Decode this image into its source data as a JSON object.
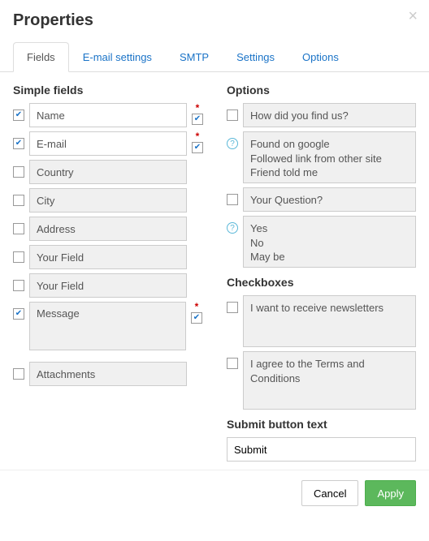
{
  "header": {
    "title": "Properties"
  },
  "tabs": [
    {
      "label": "Fields",
      "active": true
    },
    {
      "label": "E-mail settings"
    },
    {
      "label": "SMTP"
    },
    {
      "label": "Settings"
    },
    {
      "label": "Options"
    }
  ],
  "simpleFields": {
    "heading": "Simple fields",
    "items": [
      {
        "label": "Name",
        "checked": true,
        "required": true
      },
      {
        "label": "E-mail",
        "checked": true,
        "required": true
      },
      {
        "label": "Country",
        "checked": false
      },
      {
        "label": "City",
        "checked": false
      },
      {
        "label": "Address",
        "checked": false
      },
      {
        "label": "Your Field",
        "checked": false
      },
      {
        "label": "Your Field",
        "checked": false
      },
      {
        "label": "Message",
        "checked": true,
        "required": true,
        "textarea": true
      },
      {
        "label": "Attachments",
        "checked": false
      }
    ]
  },
  "options": {
    "heading": "Options",
    "questionA": {
      "label": "How did you find us?",
      "checked": false
    },
    "answersA": "Found on google\nFollowed link from other site\nFriend told me",
    "questionB": {
      "label": "Your Question?",
      "checked": false
    },
    "answersB": "Yes\nNo\nMay be"
  },
  "checkboxes": {
    "heading": "Checkboxes",
    "items": [
      {
        "label": "I want to receive newsletters",
        "checked": false
      },
      {
        "label": "I agree to the Terms and Conditions",
        "checked": false
      }
    ]
  },
  "submit": {
    "heading": "Submit button text",
    "value": "Submit"
  },
  "footer": {
    "cancel": "Cancel",
    "apply": "Apply"
  }
}
